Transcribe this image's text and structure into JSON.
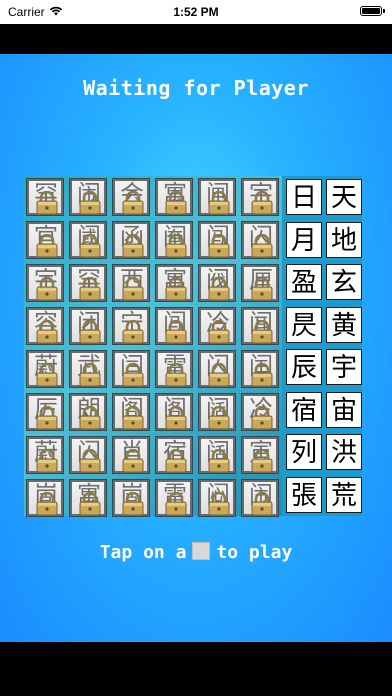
{
  "status_bar": {
    "carrier": "Carrier",
    "time": "1:52 PM"
  },
  "header": {
    "title": "Waiting for Player"
  },
  "board": {
    "locked_glyphs": [
      [
        "罕",
        "闹",
        "会",
        "寓",
        "闸",
        "宇"
      ],
      [
        "官",
        "阈",
        "函",
        "阉",
        "闯",
        "闪"
      ],
      [
        "宇",
        "罕",
        "西",
        "寓",
        "阀",
        "厘"
      ],
      [
        "容",
        "闭",
        "宁",
        "闯",
        "冷",
        "闻"
      ],
      [
        "蔚",
        "武",
        "闫",
        "雷",
        "闪",
        "闰"
      ],
      [
        "厉",
        "朗",
        "阁",
        "阁",
        "阔",
        "冷"
      ],
      [
        "蔚",
        "闪",
        "肖",
        "宿",
        "阔",
        "寅"
      ],
      [
        "崮",
        "寓",
        "崮",
        "雷",
        "闷",
        "闹"
      ]
    ],
    "answer_left": [
      "日",
      "月",
      "盈",
      "昃",
      "辰",
      "宿",
      "列",
      "張"
    ],
    "answer_right": [
      "天",
      "地",
      "玄",
      "黄",
      "宇",
      "宙",
      "洪",
      "荒"
    ]
  },
  "footer": {
    "tap_prefix": "Tap on a",
    "tap_suffix": "to play"
  },
  "colors": {
    "background": "#1a8cff",
    "tile_border": "#2b4b57",
    "lock": "#c9a85a"
  },
  "icons": {
    "lock": "padlock-icon",
    "wifi": "wifi-icon",
    "battery": "battery-icon"
  }
}
